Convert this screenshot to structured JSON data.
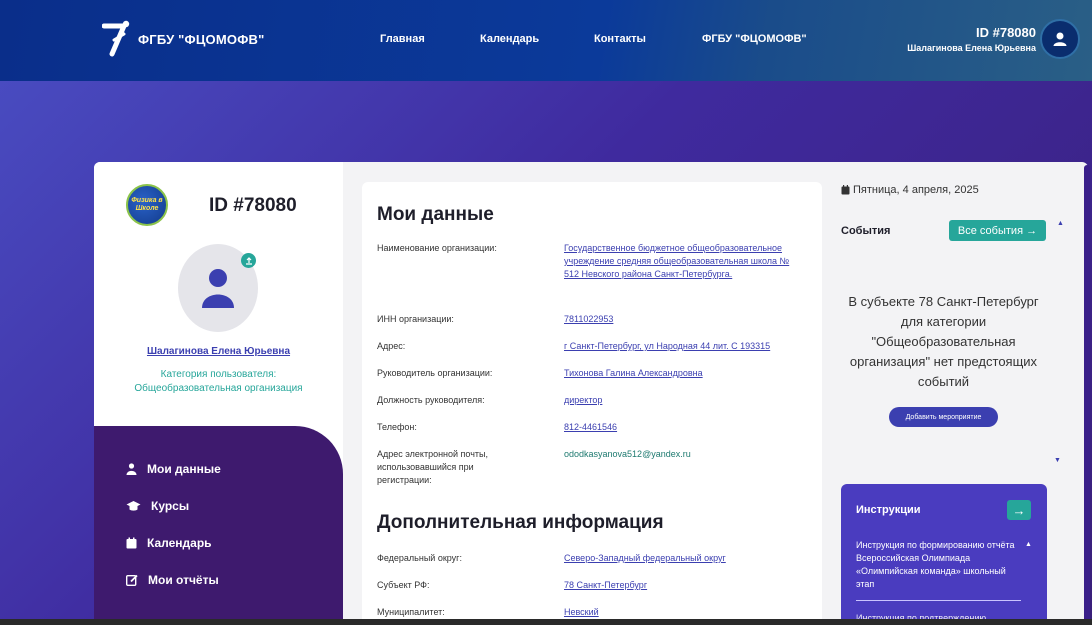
{
  "header": {
    "logo_text": "ФГБУ \"ФЦОМОФВ\"",
    "nav": [
      "Главная",
      "Календарь",
      "Контакты",
      "ФГБУ \"ФЦОМОФВ\""
    ],
    "user_id": "ID #78080",
    "user_name": "Шалагинова Елена Юрьевна",
    "avatar_icon": "user-icon"
  },
  "profile": {
    "logo_text": "Физика в Школе",
    "id": "ID #78080",
    "name": "Шалагинова Елена Юрьевна",
    "category_label": "Категория пользователя:",
    "category_value": "Общеобразовательная организация"
  },
  "menu": [
    {
      "label": "Мои данные",
      "icon": "user-icon"
    },
    {
      "label": "Курсы",
      "icon": "graduation-cap-icon"
    },
    {
      "label": "Календарь",
      "icon": "calendar-icon"
    },
    {
      "label": "Мои отчёты",
      "icon": "edit-icon"
    }
  ],
  "my_data": {
    "title": "Мои данные",
    "fields": [
      {
        "label": "Наименование организации:",
        "value": "Государственное бюджетное общеобразовательное учреждение средняя общеобразовательная школа № 512 Невского района Санкт-Петербурга."
      },
      {
        "label": "ИНН организации:",
        "value": "7811022953"
      },
      {
        "label": "Адрес:",
        "value": "г Санкт-Петербург, ул Народная 44 лит. С 193315"
      },
      {
        "label": "Руководитель организации:",
        "value": "Тихонова Галина Александровна"
      },
      {
        "label": "Должность руководителя:",
        "value": "директор"
      },
      {
        "label": "Телефон:",
        "value": "812-4461546"
      },
      {
        "label": "Адрес электронной почты, использовавшийся при регистрации:",
        "value": "ododkasyanova512@yandex.ru"
      }
    ]
  },
  "extra": {
    "title": "Дополнительная информация",
    "fields": [
      {
        "label": "Федеральный округ:",
        "value": "Северо-Западный федеральный округ"
      },
      {
        "label": "Субъект РФ:",
        "value": "78 Санкт-Петербург"
      },
      {
        "label": "Муниципалитет:",
        "value": "Невский"
      }
    ]
  },
  "events": {
    "date": "Пятница, 4 апреля, 2025",
    "title": "События",
    "all_button": "Все события →",
    "message": "В субъекте 78 Санкт-Петербург для категории \"Общеобразовательная организация\" нет предстоящих событий",
    "add_button": "Добавить мероприятие"
  },
  "instructions": {
    "title": "Инструкции",
    "button": "→",
    "item1": "Инструкция по формированию отчёта Всероссийская Олимпиада «Олимпийская команда» школьный этап",
    "item2": "Инструкция по подтверждению"
  },
  "colors": {
    "accent": "#26a69a",
    "primary": "#3b3fb0",
    "menu_bg": "#3e1a6e",
    "header_bg": "#0a2e8a"
  }
}
